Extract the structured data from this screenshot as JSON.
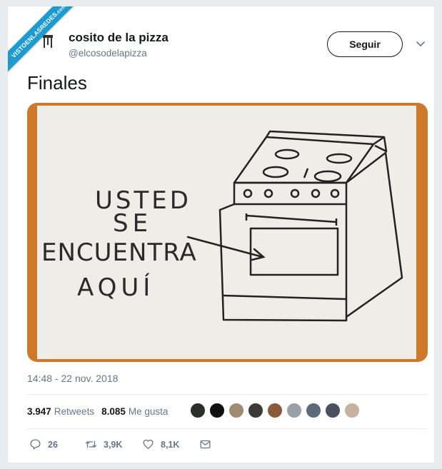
{
  "watermark": {
    "label": "VISTOENLASREDES",
    "sublabel": ".com"
  },
  "tweet": {
    "author_name": "cosito de la pizza",
    "author_handle": "@elcosodelapizza",
    "follow_label": "Seguir",
    "text": "Finales",
    "timestamp": "14:48 - 22 nov. 2018",
    "retweets_count": "3.947",
    "retweets_label": "Retweets",
    "likes_count": "8.085",
    "likes_label": "Me gusta"
  },
  "image_sign": {
    "lines": [
      "USTED",
      "SE",
      "ENCUENTRA",
      "AQUÍ"
    ]
  },
  "actions": {
    "reply_count": "26",
    "retweet_count": "3,9K",
    "like_count": "8,1K"
  },
  "liker_faces": [
    "#2a2f2a",
    "#111111",
    "#a08a70",
    "#3c3a38",
    "#8a5a3c",
    "#9aa0a8",
    "#5b6b7a",
    "#4a5060",
    "#c7b2a2"
  ],
  "colors": {
    "accent": "#1d9bd1",
    "text": "#14171a",
    "muted": "#657786",
    "board": "#f3f2ee",
    "frame": "#d97f2a"
  },
  "icons": [
    "chevron-down-icon",
    "reply-icon",
    "retweet-icon",
    "heart-icon",
    "message-icon"
  ]
}
